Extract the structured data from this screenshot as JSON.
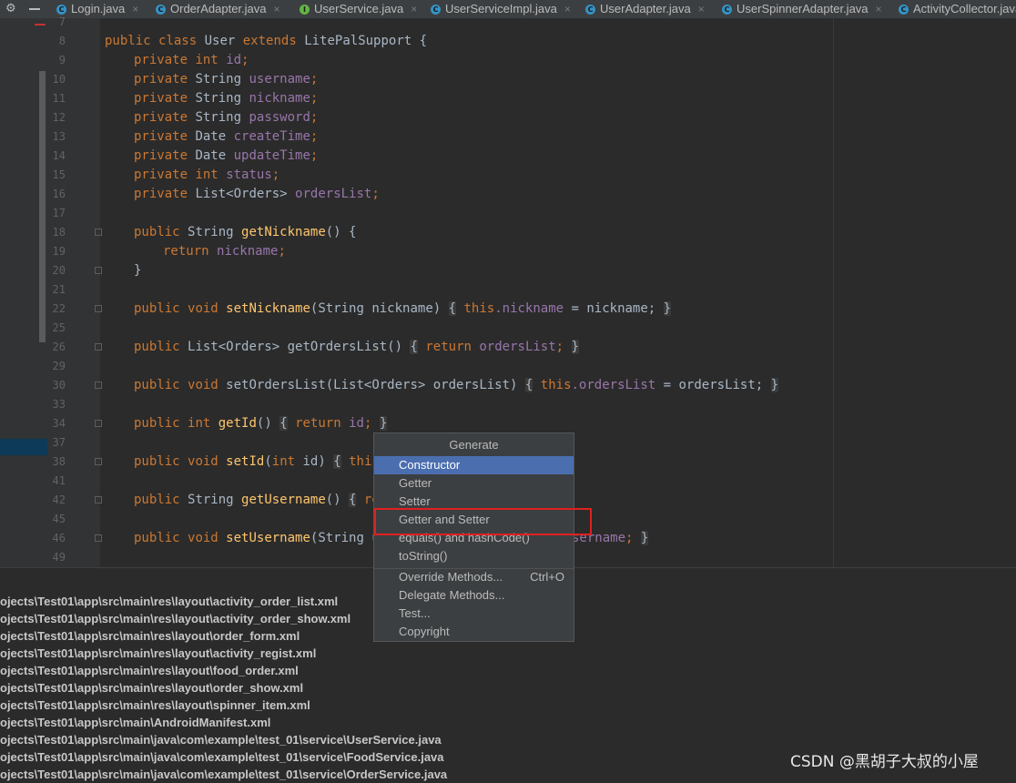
{
  "tabs": [
    {
      "label": "Login.java",
      "icon": "class-icon"
    },
    {
      "label": "OrderAdapter.java",
      "icon": "class-icon"
    },
    {
      "label": "UserService.java",
      "icon": "interface-icon"
    },
    {
      "label": "UserServiceImpl.java",
      "icon": "class-icon"
    },
    {
      "label": "UserAdapter.java",
      "icon": "class-icon"
    },
    {
      "label": "UserSpinnerAdapter.java",
      "icon": "class-icon"
    },
    {
      "label": "ActivityCollector.java",
      "icon": "class-icon"
    }
  ],
  "tab_close": "×",
  "toolbar": {
    "settings_glyph": "⚙"
  },
  "icon_letters": {
    "class": "C",
    "interface": "I"
  },
  "line_numbers": [
    "7",
    "8",
    "9",
    "10",
    "11",
    "12",
    "13",
    "14",
    "15",
    "16",
    "17",
    "18",
    "19",
    "20",
    "21",
    "22",
    "25",
    "26",
    "29",
    "30",
    "33",
    "34",
    "37",
    "38",
    "41",
    "42",
    "45",
    "46",
    "49"
  ],
  "code": {
    "l8": [
      "public",
      " ",
      "class",
      " User ",
      "extends",
      " LitePalSupport {"
    ],
    "fields": [
      {
        "type": "int",
        "name": "id"
      },
      {
        "type": "String",
        "name": "username"
      },
      {
        "type": "String",
        "name": "nickname"
      },
      {
        "type": "String",
        "name": "password"
      },
      {
        "type": "Date",
        "name": "createTime"
      },
      {
        "type": "Date",
        "name": "updateTime"
      },
      {
        "type": "int",
        "name": "status"
      },
      {
        "type": "List<Orders>",
        "name": "ordersList"
      }
    ],
    "private_kw": "private",
    "public_kw": "public",
    "semicolon": ";",
    "l18_type": "String",
    "l18_name": "getNickname",
    "l18_rest": "() {",
    "l19_ret": "return",
    "l19_field": "nickname",
    "l20": "}",
    "l22_void": "void",
    "l22_name": "setNickname",
    "l22_params": "(String nickname)",
    "l22_open": "{",
    "l22_this": "this",
    "l22_field": ".nickname",
    "l22_assign": " = nickname;",
    "l22_close": "}",
    "l26_type": "List<Orders>",
    "l26_name": "getOrdersList",
    "l26_parens": "()",
    "l26_open": "{",
    "l26_ret": "return",
    "l26_field": "ordersList",
    "l26_close": "}",
    "l30_name": "setOrdersList",
    "l30_params": "(List<Orders> ordersList)",
    "l30_field": ".ordersList",
    "l30_assign": " = ordersList;",
    "l34_type": "int",
    "l34_name": "getId",
    "l34_parens": "()",
    "l34_field": "id",
    "l38_name": "setId",
    "l38_params_open": "(",
    "l38_int": "int",
    "l38_params_close": " id)",
    "l38_dot": ".",
    "l42_name": "getUsername",
    "l42_ret_partial": "ret",
    "l46_name": "setUsername",
    "l46_params_partial": "(String us",
    "l46_tail_field": "sername",
    "l46_tail_rest": ";"
  },
  "generate_menu": {
    "title": "Generate",
    "items": [
      {
        "label": "Constructor",
        "shortcut": "",
        "selected": true
      },
      {
        "label": "Getter",
        "shortcut": ""
      },
      {
        "label": "Setter",
        "shortcut": ""
      },
      {
        "label": "Getter and Setter",
        "shortcut": "",
        "highlighted": true
      },
      {
        "label": "equals() and hashCode()",
        "shortcut": ""
      },
      {
        "label": "toString()",
        "shortcut": ""
      },
      {
        "label": "Override Methods...",
        "shortcut": "Ctrl+O"
      },
      {
        "label": "Delegate Methods...",
        "shortcut": ""
      },
      {
        "label": "Test...",
        "shortcut": ""
      },
      {
        "label": "Copyright",
        "shortcut": ""
      }
    ]
  },
  "output_lines": [
    "ojects\\Test01\\app\\src\\main\\res\\layout\\activity_order_list.xml",
    "ojects\\Test01\\app\\src\\main\\res\\layout\\activity_order_show.xml",
    "ojects\\Test01\\app\\src\\main\\res\\layout\\order_form.xml",
    "ojects\\Test01\\app\\src\\main\\res\\layout\\activity_regist.xml",
    "ojects\\Test01\\app\\src\\main\\res\\layout\\food_order.xml",
    "ojects\\Test01\\app\\src\\main\\res\\layout\\order_show.xml",
    "ojects\\Test01\\app\\src\\main\\res\\layout\\spinner_item.xml",
    "ojects\\Test01\\app\\src\\main\\AndroidManifest.xml",
    "ojects\\Test01\\app\\src\\main\\java\\com\\example\\test_01\\service\\UserService.java",
    "ojects\\Test01\\app\\src\\main\\java\\com\\example\\test_01\\service\\FoodService.java",
    "ojects\\Test01\\app\\src\\main\\java\\com\\example\\test_01\\service\\OrderService.java"
  ],
  "watermark": "CSDN @黑胡子大叔的小屋"
}
